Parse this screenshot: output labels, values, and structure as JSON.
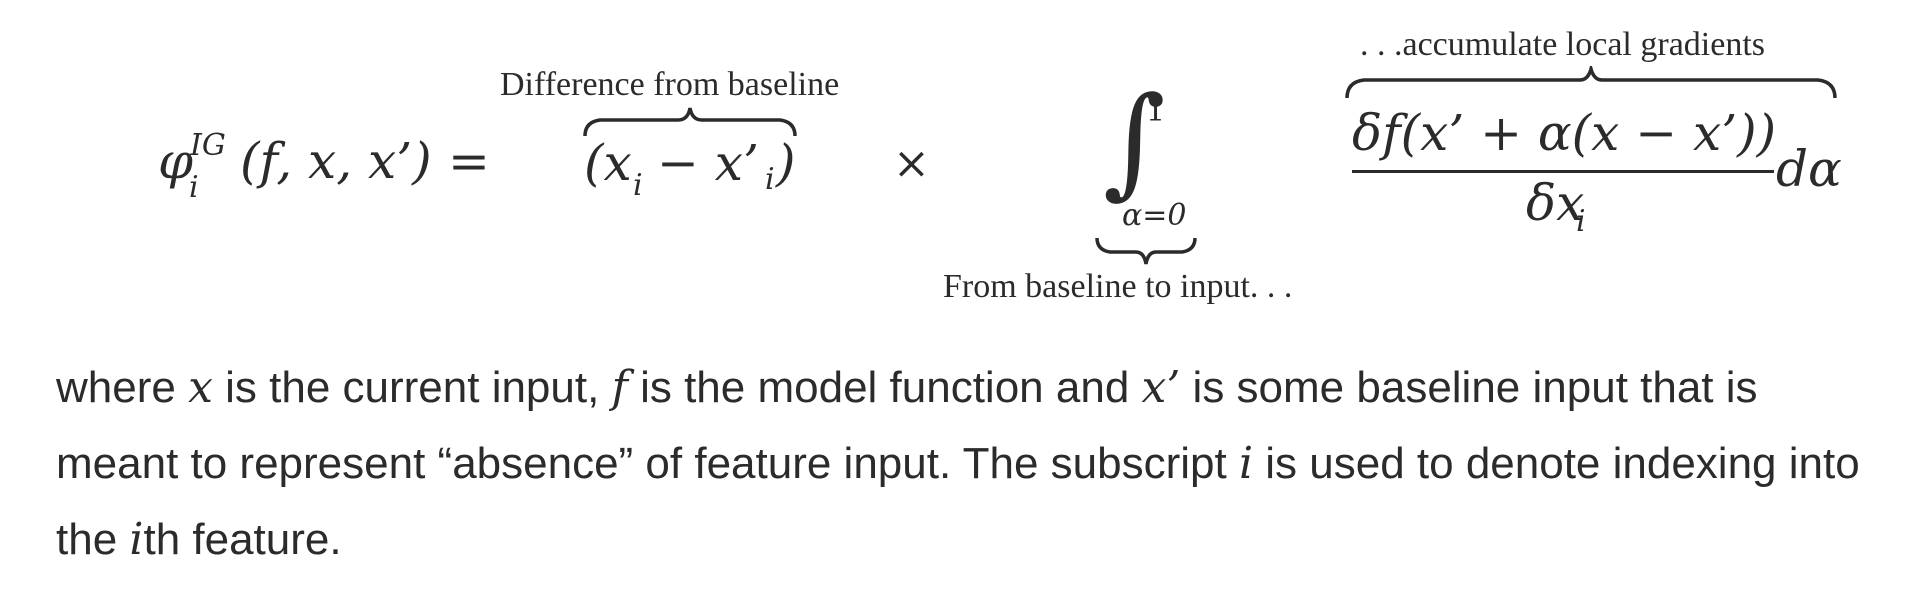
{
  "formula": {
    "lhs_symbol": "φ",
    "lhs_superscript": "IG",
    "lhs_subscript": "i",
    "lhs_args": "(f, x, x’)",
    "equals": "=",
    "difference_term": "(x",
    "difference_term_sub_i": "i",
    "difference_minus": "− x’",
    "difference_close": ")",
    "times": "×",
    "integral_sign": "∫",
    "integral_upper": "1",
    "integral_lower": "α=0",
    "numerator": "δf(x’ + α(x − x’))",
    "denominator": "δx",
    "denominator_sub": "i",
    "differential": "dα"
  },
  "annotations": {
    "difference": "Difference from baseline",
    "integral": "From baseline to input. . .",
    "gradient": ". . .accumulate local gradients"
  },
  "paragraph": {
    "line1_a": "where ",
    "var_x": "x",
    "line1_b": " is the current input, ",
    "var_f": "f",
    "line1_c": " is the model function and ",
    "var_xprime": "x’",
    "line1_d": " is some baseline input that is",
    "line2_a": "meant to represent “absence” of feature input. The subscript ",
    "var_i": "i",
    "line2_b": " is used to denote indexing into",
    "line3_a": "the ",
    "var_i2": "i",
    "line3_b": "th feature."
  }
}
